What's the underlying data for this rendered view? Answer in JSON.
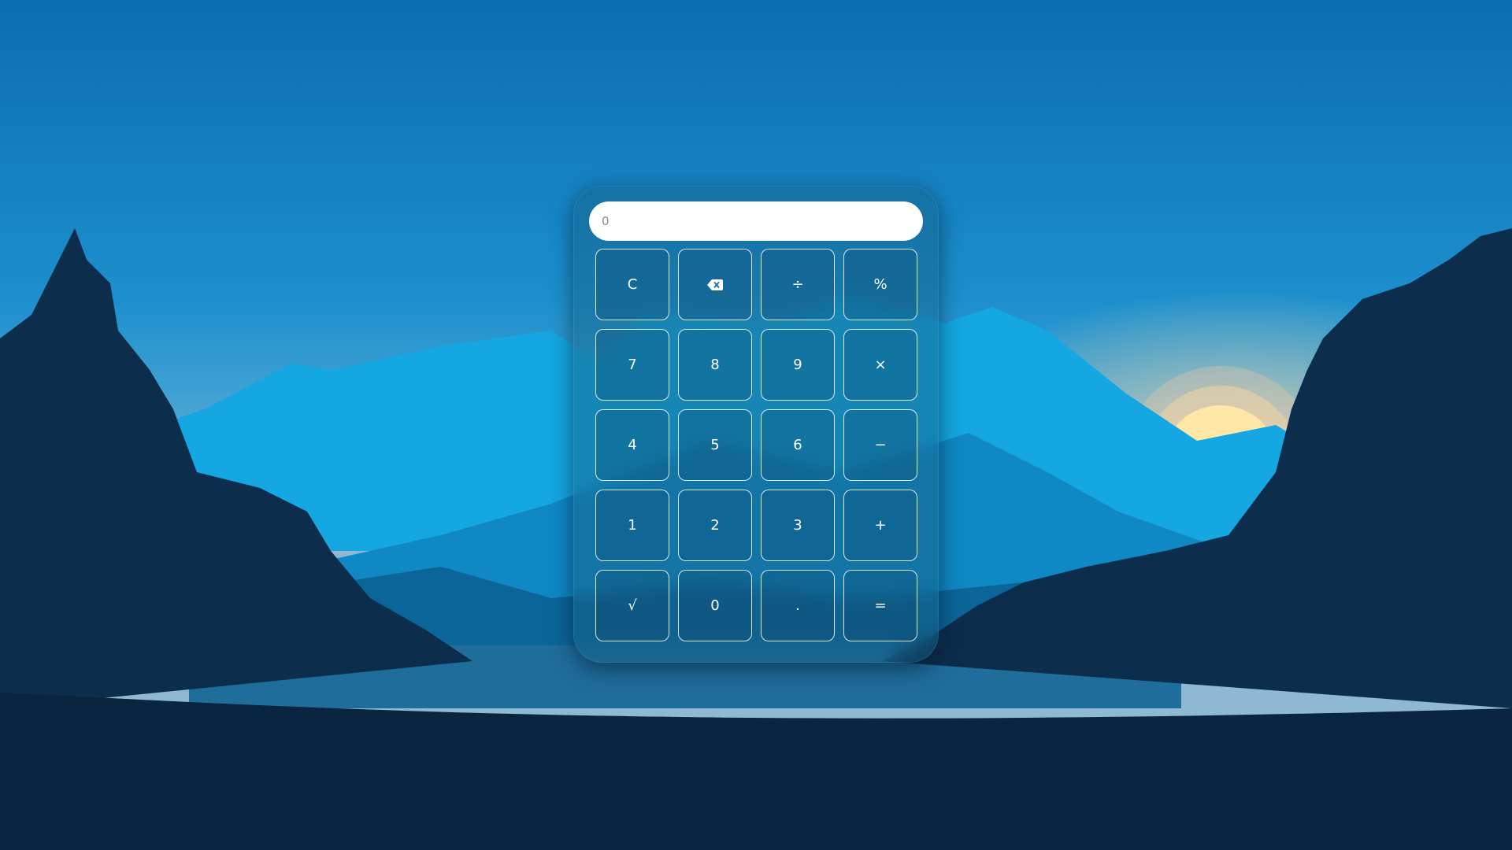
{
  "calculator": {
    "display": {
      "value": "",
      "placeholder": "0"
    },
    "keys": [
      {
        "label": "C",
        "name": "clear-button"
      },
      {
        "label": "",
        "name": "backspace-button",
        "icon": "backspace-icon"
      },
      {
        "label": "÷",
        "name": "divide-button"
      },
      {
        "label": "%",
        "name": "percent-button"
      },
      {
        "label": "7",
        "name": "digit-7-button"
      },
      {
        "label": "8",
        "name": "digit-8-button"
      },
      {
        "label": "9",
        "name": "digit-9-button"
      },
      {
        "label": "×",
        "name": "multiply-button"
      },
      {
        "label": "4",
        "name": "digit-4-button"
      },
      {
        "label": "5",
        "name": "digit-5-button"
      },
      {
        "label": "6",
        "name": "digit-6-button"
      },
      {
        "label": "−",
        "name": "subtract-button"
      },
      {
        "label": "1",
        "name": "digit-1-button"
      },
      {
        "label": "2",
        "name": "digit-2-button"
      },
      {
        "label": "3",
        "name": "digit-3-button"
      },
      {
        "label": "+",
        "name": "add-button"
      },
      {
        "label": "√",
        "name": "square-root-button"
      },
      {
        "label": "0",
        "name": "digit-0-button"
      },
      {
        "label": ".",
        "name": "decimal-button"
      },
      {
        "label": "=",
        "name": "equals-button"
      }
    ]
  },
  "colors": {
    "sky_top": "#0a6fb3",
    "sky_mid": "#1c92cf",
    "horizon_glow": "#c9b9a8",
    "sun": "#ffe6a6",
    "mountain_light": "#13a6e0",
    "mountain_mid": "#0d86c2",
    "forest_dark": "#0c2d4b",
    "ground": "#0a2540"
  }
}
